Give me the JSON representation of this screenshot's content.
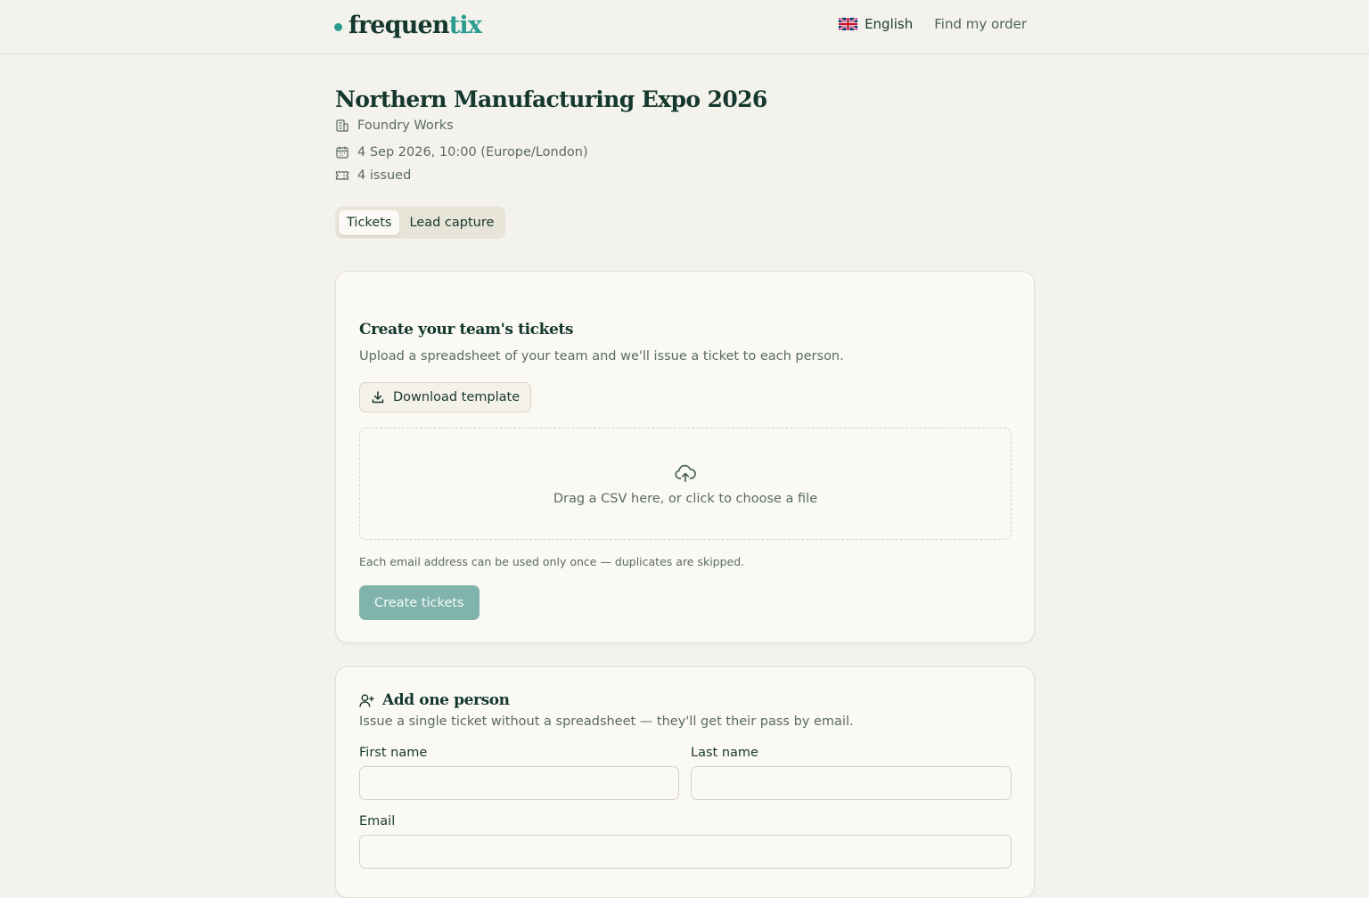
{
  "header": {
    "logo_main": "frequen",
    "logo_accent": "tix",
    "language": "English",
    "find_order": "Find my order"
  },
  "event": {
    "title": "Northern Manufacturing Expo 2026",
    "venue": "Foundry Works",
    "datetime": "4 Sep 2026, 10:00 (Europe/London)",
    "issued": "4 issued"
  },
  "tabs": [
    {
      "label": "Tickets",
      "active": true
    },
    {
      "label": "Lead capture",
      "active": false
    }
  ],
  "bulk": {
    "title": "Create your team's tickets",
    "subtitle": "Upload a spreadsheet of your team and we'll issue a ticket to each person.",
    "download_label": "Download template",
    "dropzone_text": "Drag a CSV here, or click to choose a file",
    "hint": "Each email address can be used only once — duplicates are skipped.",
    "create_label": "Create tickets"
  },
  "single": {
    "title": "Add one person",
    "subtitle": "Issue a single ticket without a spreadsheet — they'll get their pass by email.",
    "first_name_label": "First name",
    "first_name_value": "",
    "last_name_label": "Last name",
    "last_name_value": "",
    "email_label": "Email",
    "email_value": ""
  },
  "colors": {
    "accent": "#2a9d8f",
    "primary_text": "#14372e",
    "background": "#f4f2ec",
    "button_disabled": "#7fb3ac"
  }
}
